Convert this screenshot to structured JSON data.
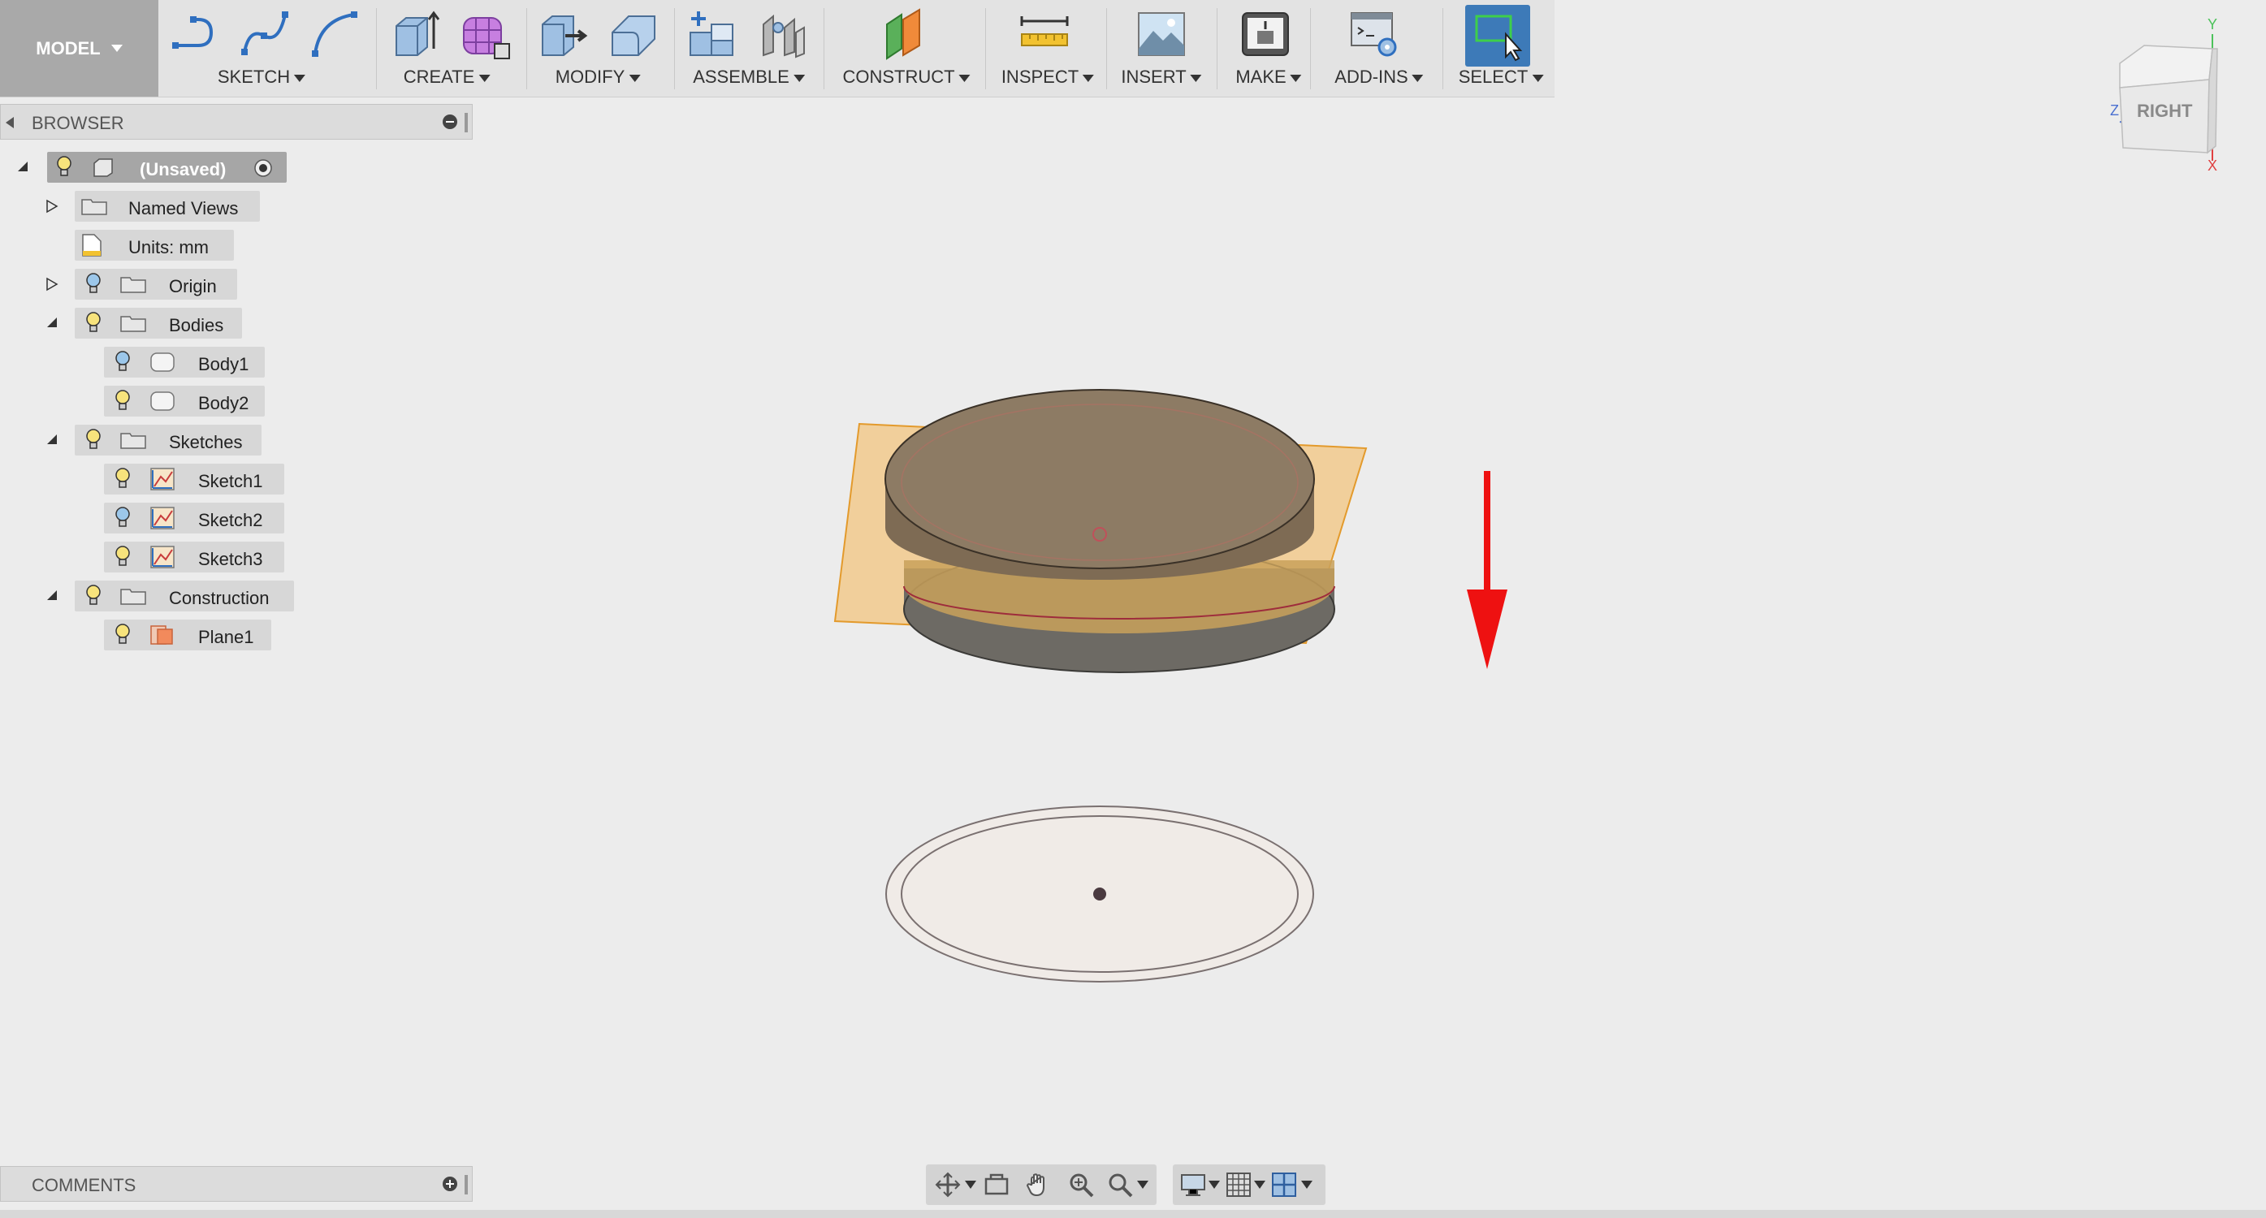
{
  "toolbar": {
    "mode_label": "MODEL",
    "groups": [
      {
        "label": "SKETCH",
        "icons": [
          "sketch-line-icon",
          "sketch-spline-icon",
          "sketch-arc-icon"
        ]
      },
      {
        "label": "CREATE",
        "icons": [
          "extrude-icon",
          "form-icon"
        ]
      },
      {
        "label": "MODIFY",
        "icons": [
          "press-pull-icon",
          "fillet-icon"
        ]
      },
      {
        "label": "ASSEMBLE",
        "icons": [
          "new-component-icon",
          "joint-icon"
        ]
      },
      {
        "label": "CONSTRUCT",
        "icons": [
          "construct-plane-icon"
        ]
      },
      {
        "label": "INSPECT",
        "icons": [
          "measure-icon"
        ]
      },
      {
        "label": "INSERT",
        "icons": [
          "insert-image-icon"
        ]
      },
      {
        "label": "MAKE",
        "icons": [
          "3d-print-icon"
        ]
      },
      {
        "label": "ADD-INS",
        "icons": [
          "scripts-icon"
        ]
      },
      {
        "label": "SELECT",
        "icons": [
          "select-icon"
        ]
      }
    ]
  },
  "browser": {
    "title": "BROWSER",
    "items": [
      {
        "label": "(Unsaved)"
      },
      {
        "label": "Named Views"
      },
      {
        "label": "Units: mm"
      },
      {
        "label": "Origin"
      },
      {
        "label": "Bodies"
      },
      {
        "label": "Body1"
      },
      {
        "label": "Body2"
      },
      {
        "label": "Sketches"
      },
      {
        "label": "Sketch1"
      },
      {
        "label": "Sketch2"
      },
      {
        "label": "Sketch3"
      },
      {
        "label": "Construction"
      },
      {
        "label": "Plane1"
      }
    ]
  },
  "comments": {
    "title": "COMMENTS"
  },
  "viewcube": {
    "face_label": "RIGHT",
    "axis_y": "Y",
    "axis_z": "Z",
    "axis_x": "X"
  },
  "colors": {
    "plane": "#f5b04f",
    "body_top": "#8f7c63",
    "arrow": "#ee1111",
    "select_active": "#3d7ab8"
  }
}
